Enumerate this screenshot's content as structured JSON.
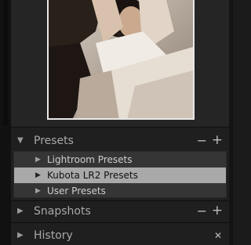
{
  "navigator": {
    "image_description_icon": "photo-preview"
  },
  "panels": {
    "presets": {
      "title": "Presets",
      "minus": "−",
      "plus": "+",
      "expand_icon": "triangle-down-icon",
      "items": [
        {
          "label": "Lightroom Presets",
          "selected": false
        },
        {
          "label": "Kubota LR2 Presets",
          "selected": true
        },
        {
          "label": "User Presets",
          "selected": false
        }
      ]
    },
    "snapshots": {
      "title": "Snapshots",
      "minus": "−",
      "plus": "+",
      "expand_icon": "triangle-right-icon"
    },
    "history": {
      "title": "History",
      "close": "✕",
      "expand_icon": "triangle-right-icon"
    }
  },
  "colors": {
    "selection": "#a9a9a9",
    "panel_bg": "#1f1f1f",
    "list_bg": "#353535"
  }
}
